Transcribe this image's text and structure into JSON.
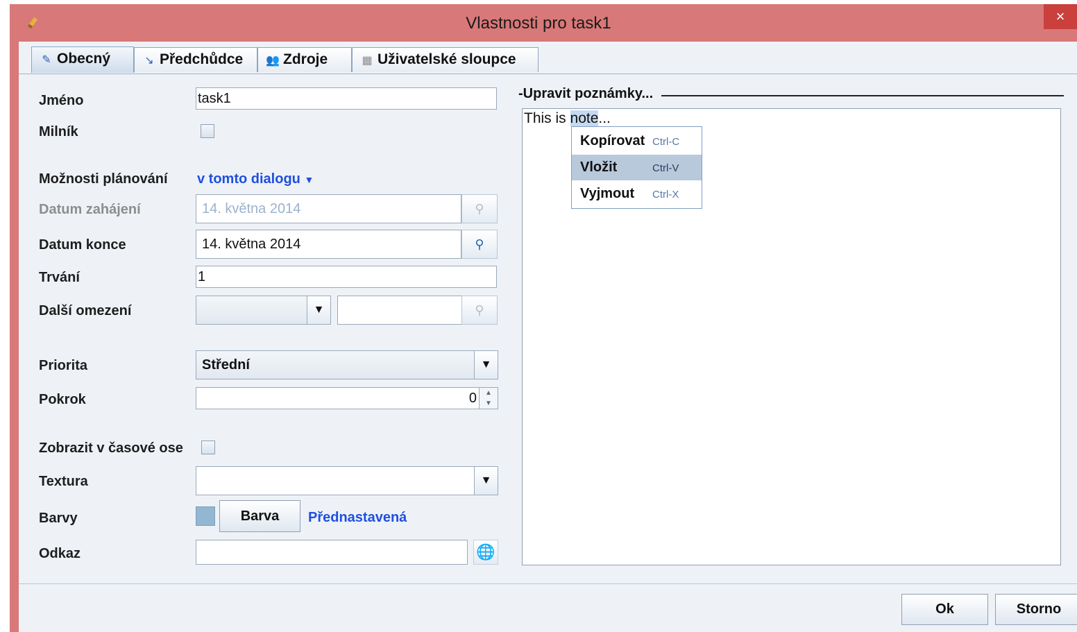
{
  "window": {
    "title": "Vlastnosti pro task1",
    "close_glyph": "×"
  },
  "tabs": [
    {
      "label": "Obecný",
      "icon": "edit-icon"
    },
    {
      "label": "Předchůdce",
      "icon": "arrow-icon"
    },
    {
      "label": "Zdroje",
      "icon": "people-icon"
    },
    {
      "label": "Uživatelské sloupce",
      "icon": "table-icon"
    }
  ],
  "form": {
    "name_label": "Jméno",
    "name_value": "task1",
    "milestone_label": "Milník",
    "scheduling_label": "Možnosti plánování",
    "scheduling_value": "v tomto dialogu",
    "start_label": "Datum zahájení",
    "start_value": "14. května 2014",
    "end_label": "Datum konce",
    "end_value": "14. května 2014",
    "duration_label": "Trvání",
    "duration_value": "1",
    "constraint_label": "Další omezení",
    "priority_label": "Priorita",
    "priority_value": "Střední",
    "progress_label": "Pokrok",
    "progress_value": "0",
    "timeline_label": "Zobrazit v časové ose",
    "texture_label": "Textura",
    "colors_label": "Barvy",
    "color_button": "Barva",
    "color_link": "Přednastavená",
    "link_label": "Odkaz"
  },
  "notes": {
    "title": "Upravit poznámky...",
    "text_before": "This is ",
    "text_selected": "note",
    "text_after": "..."
  },
  "context_menu": [
    {
      "label": "Kopírovat",
      "shortcut": "Ctrl-C"
    },
    {
      "label": "Vložit",
      "shortcut": "Ctrl-V"
    },
    {
      "label": "Vyjmout",
      "shortcut": "Ctrl-X"
    }
  ],
  "footer": {
    "ok": "Ok",
    "cancel": "Storno"
  },
  "colors": {
    "title_bar": "#d97878",
    "accent_link": "#1f4fe0",
    "swatch": "#93b7d2"
  }
}
